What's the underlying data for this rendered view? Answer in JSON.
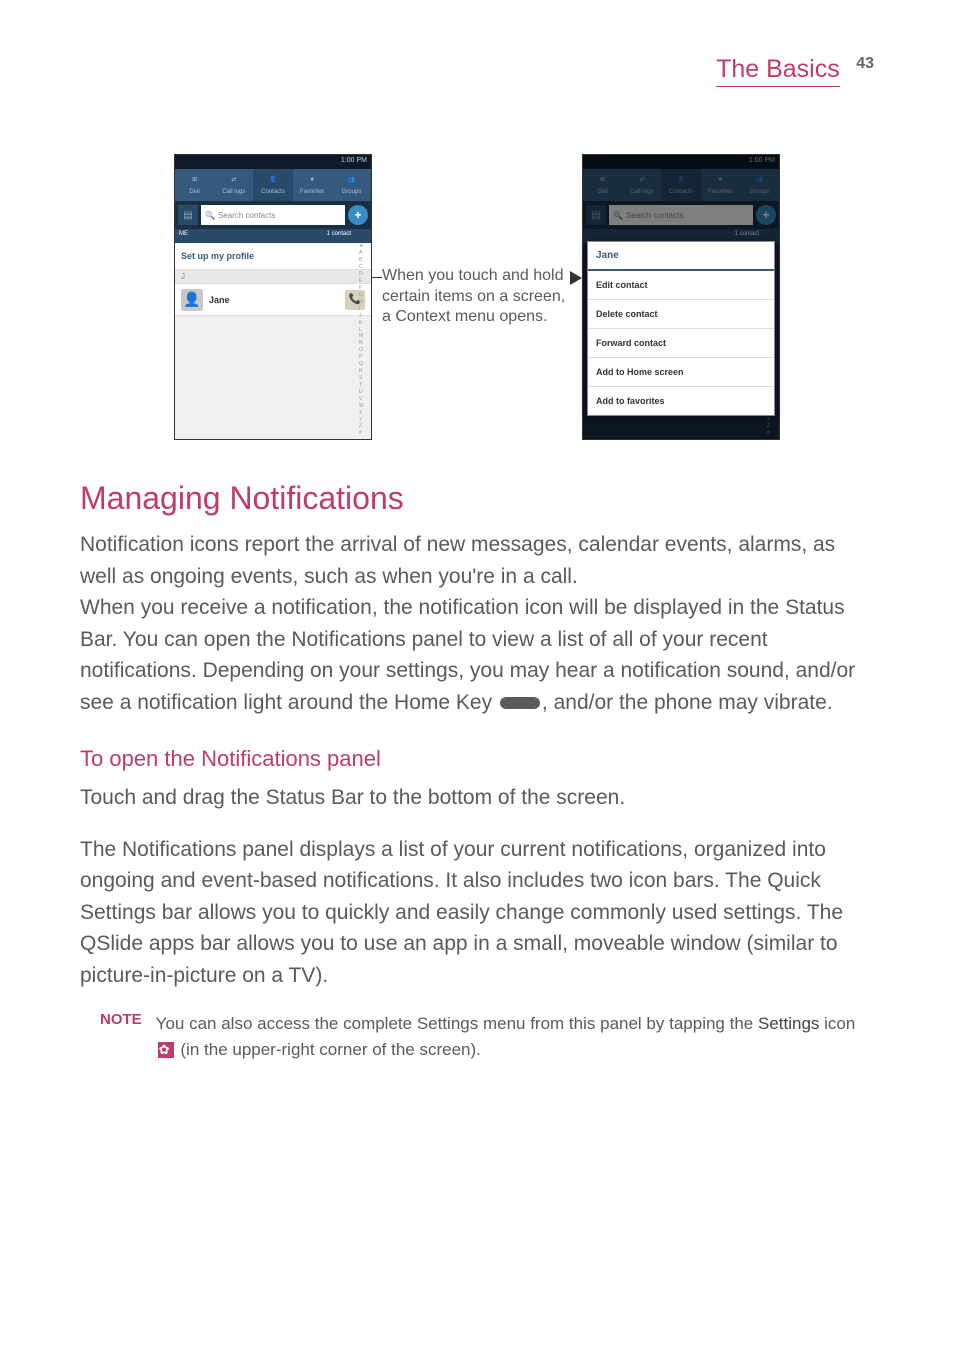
{
  "header": {
    "title": "The Basics",
    "page_number": "43"
  },
  "figure": {
    "callout": "When you touch and hold certain items on a screen, a Context menu opens.",
    "status_time": "1:00 PM",
    "tabs": [
      "Dial",
      "Call logs",
      "Contacts",
      "Favorites",
      "Groups"
    ],
    "search_placeholder": "Search contacts",
    "count_left": "ME",
    "count_right": "1 contact",
    "profile_text": "Set up my profile",
    "section_letter": "J",
    "contact_name": "Jane",
    "context_title": "Jane",
    "context_items": [
      "Edit contact",
      "Delete contact",
      "Forward contact",
      "Add to Home screen",
      "Add to favorites"
    ],
    "alpha": [
      "★",
      "A",
      "B",
      "C",
      "D",
      "E",
      "F",
      "G",
      "H",
      "I",
      "J",
      "K",
      "L",
      "M",
      "N",
      "O",
      "P",
      "Q",
      "R",
      "S",
      "T",
      "U",
      "V",
      "W",
      "X",
      "Y",
      "Z",
      "#"
    ]
  },
  "section": {
    "title": "Managing Notifications",
    "intro": "Notification icons report the arrival of new messages, calendar events, alarms, as well as ongoing events, such as when you're in a call.",
    "body1_a": "When you receive a notification, the notification icon will be displayed in the Status Bar. You can open the Notifications panel to view a list of all of your recent notifications. Depending on your settings, you may hear a notification sound, and/or see a notification light around the Home Key ",
    "body1_b": ", and/or the phone may vibrate.",
    "sub_title": "To open the Notifications panel",
    "sub_intro": "Touch and drag the Status Bar to the bottom of the screen.",
    "sub_body": "The Notifications panel displays a list of your current notifications, organized into ongoing and event-based notifications. It also includes two icon bars. The Quick Settings bar allows you to quickly and easily change commonly used settings. The QSlide apps bar allows you to use an app in a small, moveable window (similar to picture-in-picture on a TV).",
    "note_label": "NOTE",
    "note_a": "You can also access the complete Settings menu from this panel by tapping the ",
    "note_b": "Settings",
    "note_c": " icon ",
    "note_d": " (in the upper-right corner of the screen)."
  }
}
